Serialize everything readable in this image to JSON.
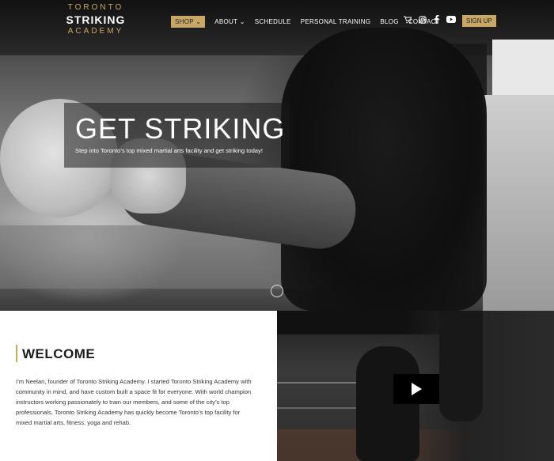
{
  "brand": {
    "line1": "TORONTO",
    "line2": "STRIKING",
    "line3": "ACADEMY",
    "accent": "#c9a867"
  },
  "nav": {
    "items": [
      {
        "label": "SHOP ⌄",
        "active": true
      },
      {
        "label": "ABOUT ⌄",
        "active": false
      },
      {
        "label": "SCHEDULE",
        "active": false
      },
      {
        "label": "PERSONAL TRAINING",
        "active": false
      },
      {
        "label": "BLOG",
        "active": false
      },
      {
        "label": "CONTACT",
        "active": false
      }
    ],
    "icons": [
      "cart-icon",
      "instagram-icon",
      "facebook-icon",
      "youtube-icon",
      "search-icon"
    ],
    "signup": "SIGN UP"
  },
  "hero": {
    "title": "GET STRIKING",
    "subtitle": "Step into Toronto’s top mixed martial arts facility and get striking today!"
  },
  "welcome": {
    "title": "WELCOME",
    "body": "I’m Neelan, founder of Toronto Striking Academy. I started Toronto Striking Academy with community in mind, and have custom built a space fit for everyone. With world champion instructors working passionately to train our members, and some of the city’s top professionals, Toronto Striking Academy has quickly become Toronto’s top facility for mixed martial arts, fitness, yoga and rehab."
  }
}
